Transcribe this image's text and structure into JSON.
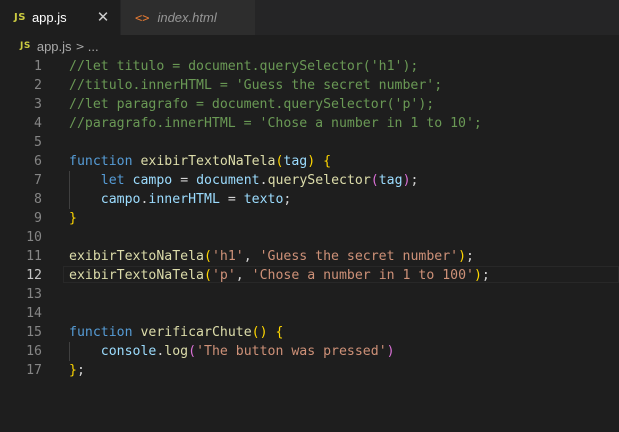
{
  "tabs": [
    {
      "icon": "JS",
      "label": "app.js",
      "active": true,
      "close": "✕"
    },
    {
      "icon": "<>",
      "label": "index.html",
      "active": false
    }
  ],
  "breadcrumb": {
    "icon": "JS",
    "file": "app.js",
    "separator": ">",
    "more": "..."
  },
  "editor": {
    "current_line": 12,
    "lines": [
      {
        "n": "1",
        "tokens": [
          [
            "comment",
            "//let titulo = document.querySelector('h1');"
          ]
        ]
      },
      {
        "n": "2",
        "tokens": [
          [
            "comment",
            "//titulo.innerHTML = 'Guess the secret number';"
          ]
        ]
      },
      {
        "n": "3",
        "tokens": [
          [
            "comment",
            "//let paragrafo = document.querySelector('p');"
          ]
        ]
      },
      {
        "n": "4",
        "tokens": [
          [
            "comment",
            "//paragrafo.innerHTML = 'Chose a number in 1 to 10';"
          ]
        ]
      },
      {
        "n": "5",
        "tokens": []
      },
      {
        "n": "6",
        "tokens": [
          [
            "kw",
            "function"
          ],
          [
            "plain",
            " "
          ],
          [
            "fn",
            "exibirTextoNaTela"
          ],
          [
            "brace",
            "("
          ],
          [
            "var",
            "tag"
          ],
          [
            "brace",
            ")"
          ],
          [
            "plain",
            " "
          ],
          [
            "brace",
            "{"
          ]
        ]
      },
      {
        "n": "7",
        "tokens": [
          [
            "plain",
            "    "
          ],
          [
            "kw",
            "let"
          ],
          [
            "plain",
            " "
          ],
          [
            "var",
            "campo"
          ],
          [
            "plain",
            " = "
          ],
          [
            "var",
            "document"
          ],
          [
            "plain",
            "."
          ],
          [
            "fn",
            "querySelector"
          ],
          [
            "paren",
            "("
          ],
          [
            "var",
            "tag"
          ],
          [
            "paren",
            ")"
          ],
          [
            "plain",
            ";"
          ]
        ]
      },
      {
        "n": "8",
        "tokens": [
          [
            "plain",
            "    "
          ],
          [
            "var",
            "campo"
          ],
          [
            "plain",
            "."
          ],
          [
            "var",
            "innerHTML"
          ],
          [
            "plain",
            " = "
          ],
          [
            "var",
            "texto"
          ],
          [
            "plain",
            ";"
          ]
        ]
      },
      {
        "n": "9",
        "tokens": [
          [
            "brace",
            "}"
          ]
        ]
      },
      {
        "n": "10",
        "tokens": []
      },
      {
        "n": "11",
        "tokens": [
          [
            "fn",
            "exibirTextoNaTela"
          ],
          [
            "brace",
            "("
          ],
          [
            "str",
            "'h1'"
          ],
          [
            "plain",
            ", "
          ],
          [
            "str",
            "'Guess the secret number'"
          ],
          [
            "brace",
            ")"
          ],
          [
            "plain",
            ";"
          ]
        ]
      },
      {
        "n": "12",
        "tokens": [
          [
            "fn",
            "exibirTextoNaTela"
          ],
          [
            "brace",
            "("
          ],
          [
            "str",
            "'p'"
          ],
          [
            "plain",
            ", "
          ],
          [
            "str",
            "'Chose a number in 1 to 100'"
          ],
          [
            "brace",
            ")"
          ],
          [
            "plain",
            ";"
          ]
        ]
      },
      {
        "n": "13",
        "tokens": []
      },
      {
        "n": "14",
        "tokens": []
      },
      {
        "n": "15",
        "tokens": [
          [
            "kw",
            "function"
          ],
          [
            "plain",
            " "
          ],
          [
            "fn",
            "verificarChute"
          ],
          [
            "brace",
            "()"
          ],
          [
            "plain",
            " "
          ],
          [
            "brace",
            "{"
          ]
        ]
      },
      {
        "n": "16",
        "tokens": [
          [
            "plain",
            "    "
          ],
          [
            "var",
            "console"
          ],
          [
            "plain",
            "."
          ],
          [
            "fn",
            "log"
          ],
          [
            "paren",
            "("
          ],
          [
            "str",
            "'The button was pressed'"
          ],
          [
            "paren",
            ")"
          ]
        ]
      },
      {
        "n": "17",
        "tokens": [
          [
            "brace",
            "}"
          ],
          [
            "plain",
            ";"
          ]
        ]
      }
    ]
  }
}
